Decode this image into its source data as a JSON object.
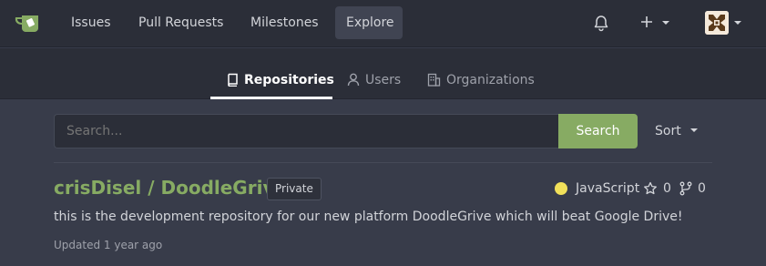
{
  "navbar": {
    "items": [
      {
        "label": "Issues"
      },
      {
        "label": "Pull Requests"
      },
      {
        "label": "Milestones"
      },
      {
        "label": "Explore",
        "active": true
      }
    ],
    "logo_icon": "gitea-teacup-icon",
    "notifications_icon": "bell-icon",
    "create_icon": "plus-icon",
    "avatar_icon": "user-avatar-icon"
  },
  "subnav": {
    "tabs": [
      {
        "label": "Repositories",
        "icon": "repo-icon",
        "active": true
      },
      {
        "label": "Users",
        "icon": "person-icon"
      },
      {
        "label": "Organizations",
        "icon": "organization-icon"
      }
    ]
  },
  "search": {
    "placeholder": "Search...",
    "value": "",
    "button_label": "Search",
    "sort_label": "Sort"
  },
  "repos": [
    {
      "owner_name": "crisDisel / DoodleGrive",
      "visibility": "Private",
      "language": "JavaScript",
      "language_color": "#f1e05a",
      "stars": "0",
      "forks": "0",
      "description": "this is the development repository for our new platform DoodleGrive which will beat Google Drive!",
      "updated": "Updated 1 year ago"
    }
  ],
  "colors": {
    "accent": "#87ab63",
    "background": "#383c4a",
    "navbar": "#2b2e38"
  }
}
